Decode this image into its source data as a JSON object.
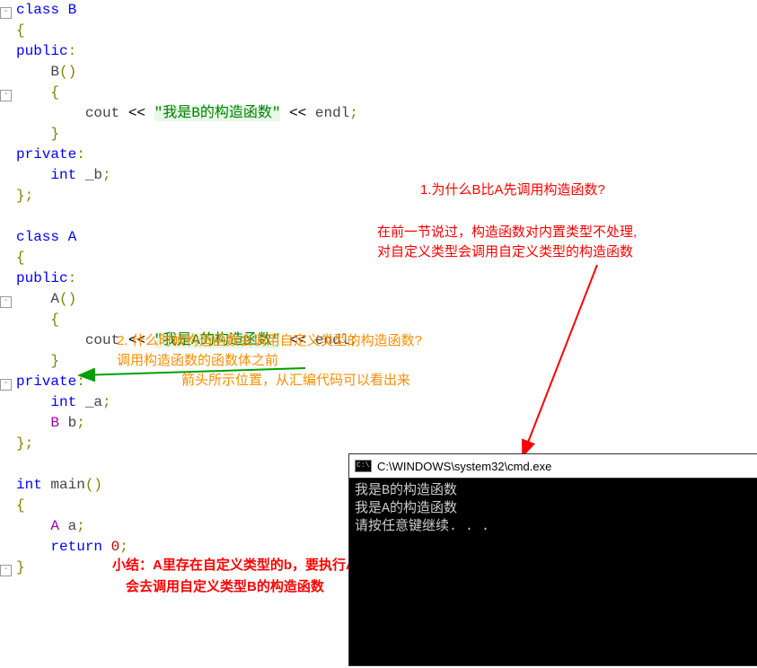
{
  "code": {
    "classB": "class B",
    "publicB": "public",
    "B_ctor_name": "B",
    "B_ctor_body": "\"我是B的构造函数\"",
    "cout": "cout",
    "endl": "endl",
    "privateB": "private",
    "int_b": "int",
    "_b": "_b",
    "classA": "class A",
    "publicA": "public",
    "A_ctor_name": "A",
    "A_ctor_body": "\"我是A的构造函数\"",
    "privateA": "private",
    "int_a": "int",
    "_a": "_a",
    "B_member": "B",
    "b_name": "b",
    "int_main": "int",
    "main": "main",
    "A_local": "A",
    "a_name": "a",
    "return_kw": "return",
    "zero": "0"
  },
  "annotations": {
    "q1_title": "1.为什么B比A先调用构造函数?",
    "q1_body": "在前一节说过，构造函数对内置类型不处理,\n对自定义类型会调用自定义类型的构造函数",
    "q2_line1": "2. 什么时候构造函数会调用自定义类型的构造函数?",
    "q2_line2": "调用构造函数的函数体之前",
    "q2_line3": "箭头所示位置，从汇编代码可以看出来",
    "summary_line1": "小结：A里存在自定义类型的b，要执行A构造函数的函数体时，",
    "summary_line2": "会去调用自定义类型B的构造函数"
  },
  "console": {
    "title": "C:\\WINDOWS\\system32\\cmd.exe",
    "line1": "我是B的构造函数",
    "line2": "我是A的构造函数",
    "line3": "请按任意键继续. . ."
  }
}
